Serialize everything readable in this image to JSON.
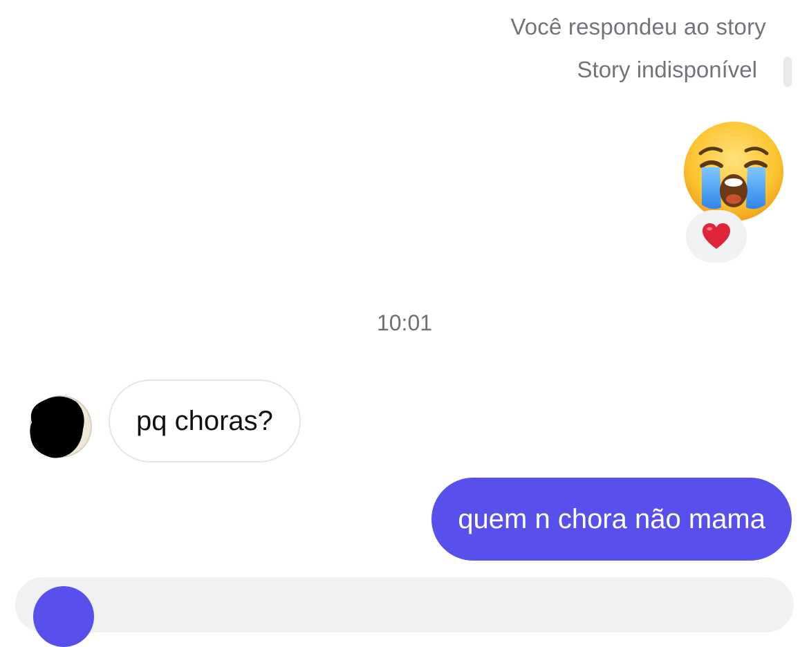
{
  "story": {
    "replied_label": "Você respondeu ao story",
    "unavailable_label": "Story indisponível"
  },
  "messages": {
    "sent_emoji": "crying-face-emoji",
    "reaction_icon": "red-heart-icon",
    "timestamp": "10:01",
    "incoming_text": "pq choras?",
    "outgoing_text": "quem n chora não mama"
  },
  "composer": {
    "camera_icon": "camera-icon"
  },
  "colors": {
    "outgoing_bubble": "#5850ec",
    "incoming_border": "#e6e6e8",
    "meta_text": "#737479",
    "heart": "#e0243a"
  }
}
